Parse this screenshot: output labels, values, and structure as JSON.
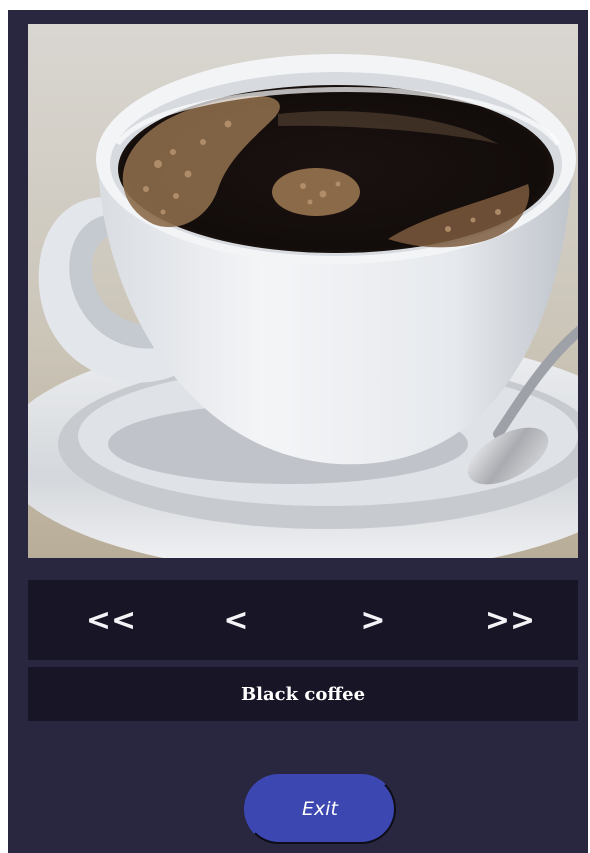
{
  "gallery": {
    "image_alt": "Black coffee",
    "caption": "Black coffee"
  },
  "nav": {
    "first_label": "<<",
    "prev_label": "<",
    "next_label": ">",
    "last_label": ">>"
  },
  "exit_label": "Exit",
  "colors": {
    "background": "#28273f",
    "bar": "#181626",
    "exit_button": "#3d47b2",
    "text": "#ffffff"
  }
}
